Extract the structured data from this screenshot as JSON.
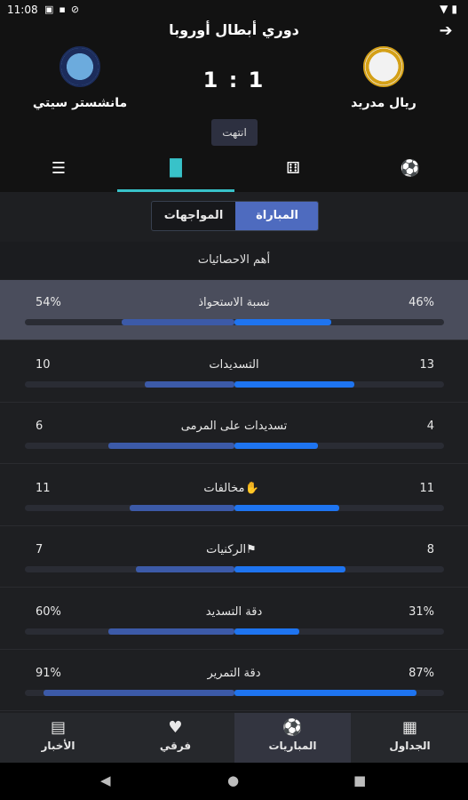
{
  "status_bar": {
    "time": "11:08",
    "icons": [
      "notification-icon",
      "gallery-icon",
      "nosync-icon",
      "wifi-icon",
      "battery-icon"
    ]
  },
  "header": {
    "league": "دوري أبطال أوروبا",
    "home_team": "ريال مدريد",
    "away_team": "مانشستر سيتي",
    "score": "1 : 1",
    "status": "انتهت"
  },
  "tabs": [
    "list-icon",
    "stats-icon",
    "lineup-icon",
    "ball-icon"
  ],
  "segment": {
    "match": "المباراة",
    "h2h": "المواجهات"
  },
  "section_title": "أهم الاحصائيات",
  "stats": [
    {
      "label": "نسبة الاستحواذ",
      "home": "46%",
      "away": "54%",
      "home_frac": 0.46,
      "away_frac": 0.54,
      "highlight": true
    },
    {
      "label": "التسديدات",
      "home": "13",
      "away": "10",
      "home_frac": 0.57,
      "away_frac": 0.43,
      "highlight": false
    },
    {
      "label": "تسديدات على المرمى",
      "home": "4",
      "away": "6",
      "home_frac": 0.4,
      "away_frac": 0.6,
      "highlight": false
    },
    {
      "label": "مخالفات",
      "home": "11",
      "away": "11",
      "home_frac": 0.5,
      "away_frac": 0.5,
      "highlight": false,
      "icon": "foul-icon"
    },
    {
      "label": "الركنيات",
      "home": "8",
      "away": "7",
      "home_frac": 0.53,
      "away_frac": 0.47,
      "highlight": false,
      "icon": "corner-flag-icon"
    },
    {
      "label": "دقة التسديد",
      "home": "31%",
      "away": "60%",
      "home_frac": 0.31,
      "away_frac": 0.6,
      "highlight": false
    },
    {
      "label": "دقة التمرير",
      "home": "87%",
      "away": "91%",
      "home_frac": 0.87,
      "away_frac": 0.91,
      "highlight": false
    }
  ],
  "bottom_nav": [
    {
      "label": "الأخبار",
      "icon": "news-icon",
      "active": false
    },
    {
      "label": "فرقي",
      "icon": "heart-icon",
      "active": false
    },
    {
      "label": "المباريات",
      "icon": "ball-icon",
      "active": true
    },
    {
      "label": "الجداول",
      "icon": "grid-icon",
      "active": false
    }
  ],
  "colors": {
    "accent": "#38c2c9",
    "home_bar": "#1e74f0",
    "away_bar": "#3c5aa8",
    "segment_active": "#4e6bbf"
  }
}
